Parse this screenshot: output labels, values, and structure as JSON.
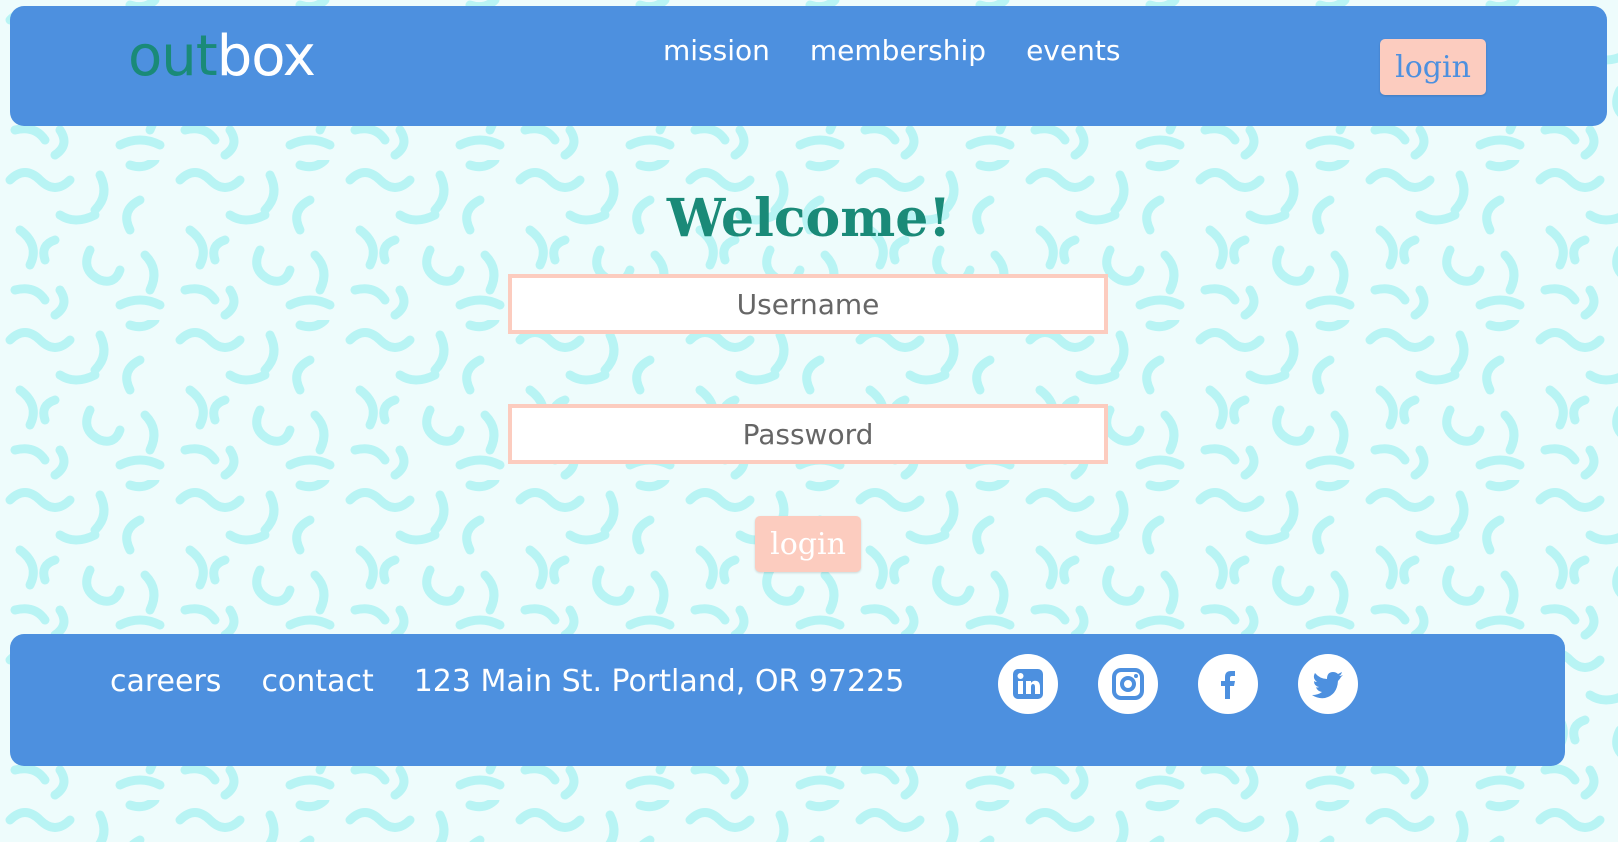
{
  "brand": {
    "logo_part1": "out",
    "logo_part2": "box"
  },
  "nav": {
    "items": [
      {
        "label": "mission"
      },
      {
        "label": "membership"
      },
      {
        "label": "events"
      }
    ]
  },
  "header": {
    "login_label": "login"
  },
  "main": {
    "title": "Welcome!",
    "username_placeholder": "Username",
    "password_placeholder": "Password",
    "login_label": "login"
  },
  "footer": {
    "links": [
      {
        "label": "careers"
      },
      {
        "label": "contact"
      }
    ],
    "address": "123 Main St. Portland, OR 97225",
    "social": [
      {
        "icon": "linkedin-icon"
      },
      {
        "icon": "instagram-icon"
      },
      {
        "icon": "facebook-icon"
      },
      {
        "icon": "twitter-icon"
      }
    ]
  },
  "colors": {
    "primary_blue": "#4d90df",
    "accent_peach": "#fcccbf",
    "logo_teal": "#1a8a78",
    "pattern_cyan": "#b8f4f4"
  }
}
